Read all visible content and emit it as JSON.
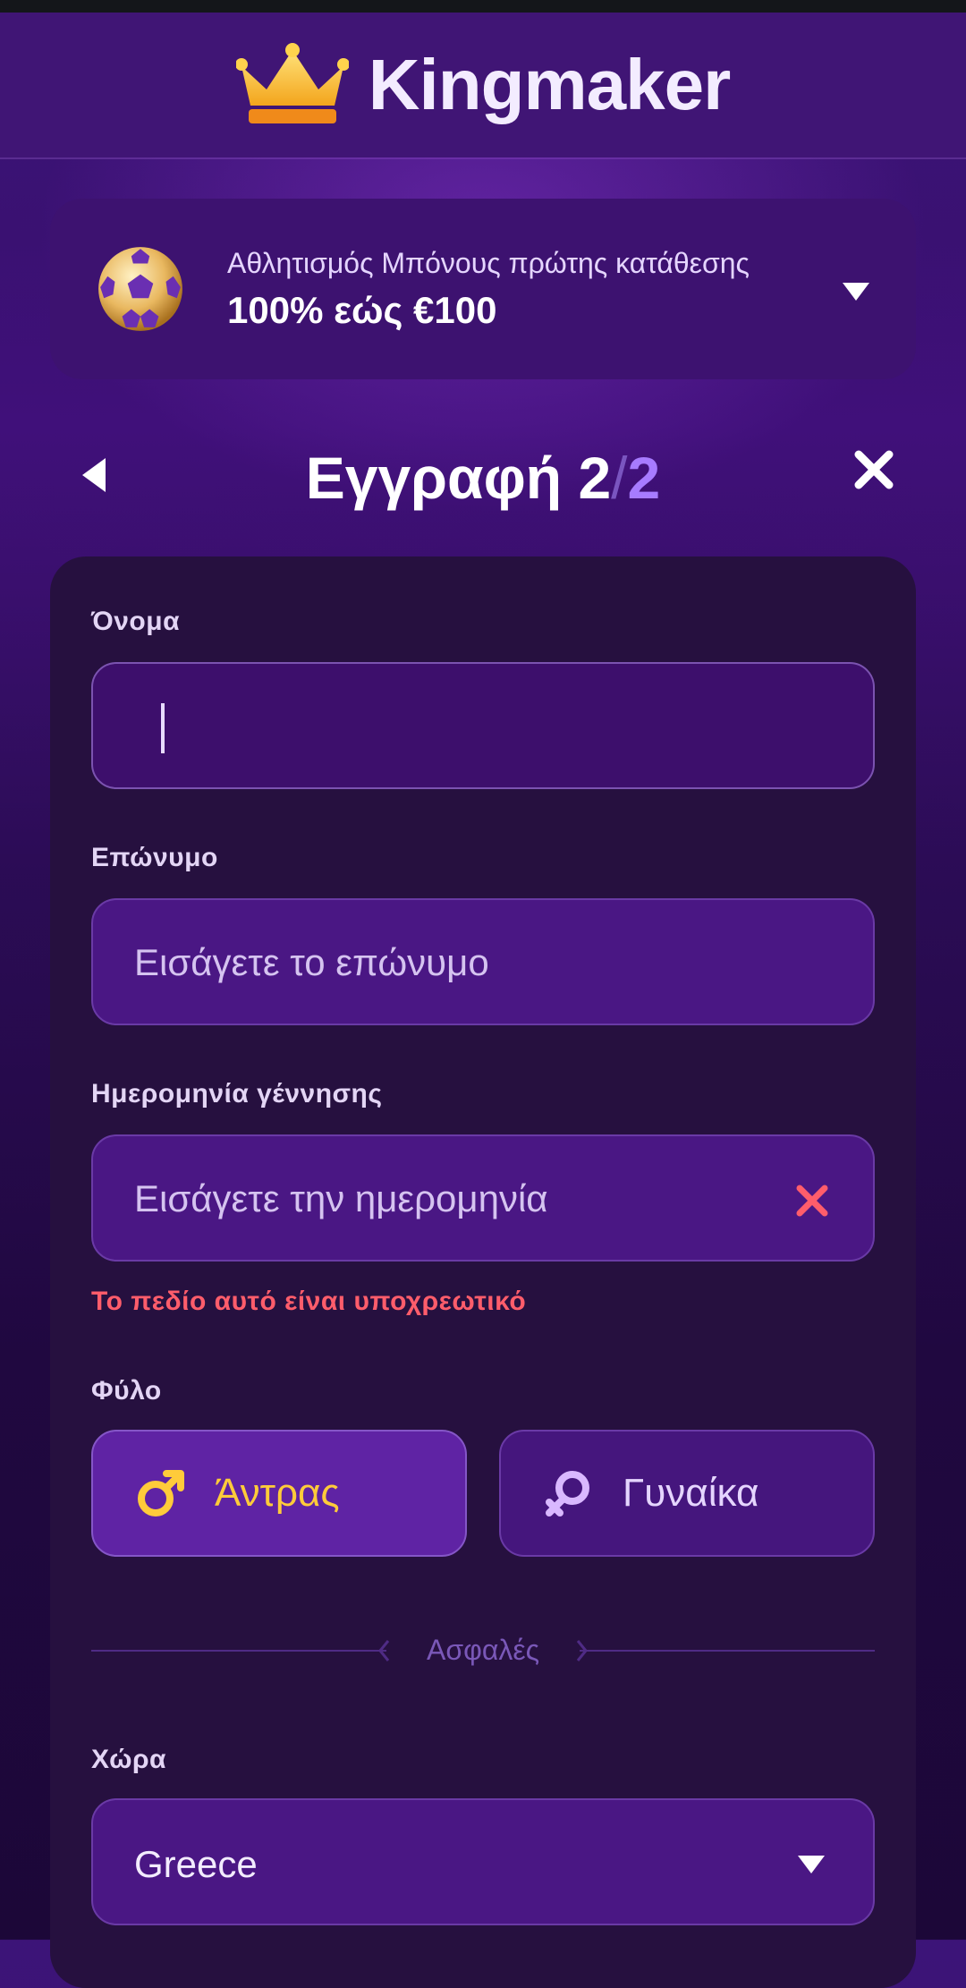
{
  "app": {
    "name": "Kingmaker"
  },
  "bonus": {
    "subtitle": "Αθλητισμός Μπόνους πρώτης κατάθεσης",
    "title": "100% εώς €100"
  },
  "step": {
    "prefix": "Εγγραφή 2",
    "slash": "/",
    "total": "2"
  },
  "form": {
    "first_name": {
      "label": "Όνομα",
      "value": ""
    },
    "last_name": {
      "label": "Επώνυμο",
      "placeholder": "Εισάγετε το επώνυμο"
    },
    "birth_date": {
      "label": "Ημερομηνία γέννησης",
      "placeholder": "Εισάγετε την ημερομηνία",
      "error": "Το πεδίο αυτό είναι υποχρεωτικό"
    },
    "gender": {
      "label": "Φύλο",
      "male": "Άντρας",
      "female": "Γυναίκα",
      "selected": "male"
    },
    "secure_divider": "Ασφαλές",
    "country": {
      "label": "Χώρα",
      "value": "Greece"
    }
  },
  "colors": {
    "accent": "#ffcb3a",
    "error": "#ff5d6b",
    "highlight": "#a77bff"
  },
  "icons": [
    "crown-icon",
    "soccer-ball-icon",
    "chevron-down-icon",
    "back-arrow-icon",
    "close-icon",
    "clear-icon",
    "male-icon",
    "female-icon"
  ]
}
